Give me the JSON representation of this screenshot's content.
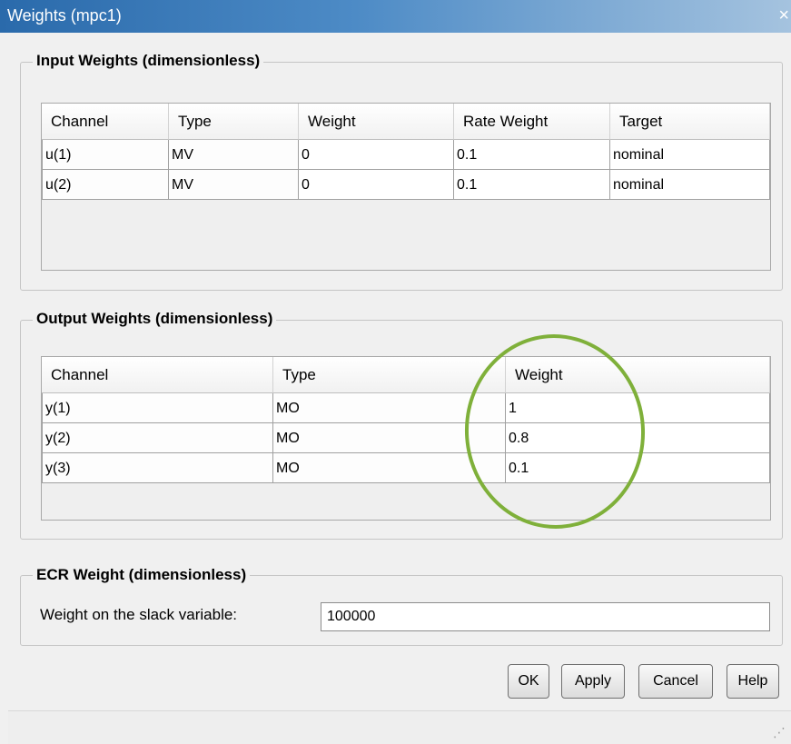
{
  "window": {
    "title": "Weights (mpc1)",
    "close_glyph": "×"
  },
  "input_weights": {
    "legend": "Input Weights (dimensionless)",
    "headers": [
      "Channel",
      "Type",
      "Weight",
      "Rate Weight",
      "Target"
    ],
    "rows": [
      {
        "channel": "u(1)",
        "type": "MV",
        "weight": "0",
        "rate_weight": "0.1",
        "target": "nominal"
      },
      {
        "channel": "u(2)",
        "type": "MV",
        "weight": "0",
        "rate_weight": "0.1",
        "target": "nominal"
      }
    ]
  },
  "output_weights": {
    "legend": "Output Weights (dimensionless)",
    "headers": [
      "Channel",
      "Type",
      "Weight"
    ],
    "rows": [
      {
        "channel": "y(1)",
        "type": "MO",
        "weight": "1"
      },
      {
        "channel": "y(2)",
        "type": "MO",
        "weight": "0.8"
      },
      {
        "channel": "y(3)",
        "type": "MO",
        "weight": "0.1"
      }
    ],
    "highlight_color": "#7fb03a"
  },
  "ecr": {
    "legend": "ECR Weight (dimensionless)",
    "label": "Weight on the slack variable:",
    "value": "100000"
  },
  "buttons": {
    "ok": "OK",
    "apply": "Apply",
    "cancel": "Cancel",
    "help": "Help"
  },
  "icons": {
    "close": "close-icon",
    "resize": "resize-grip-icon"
  }
}
